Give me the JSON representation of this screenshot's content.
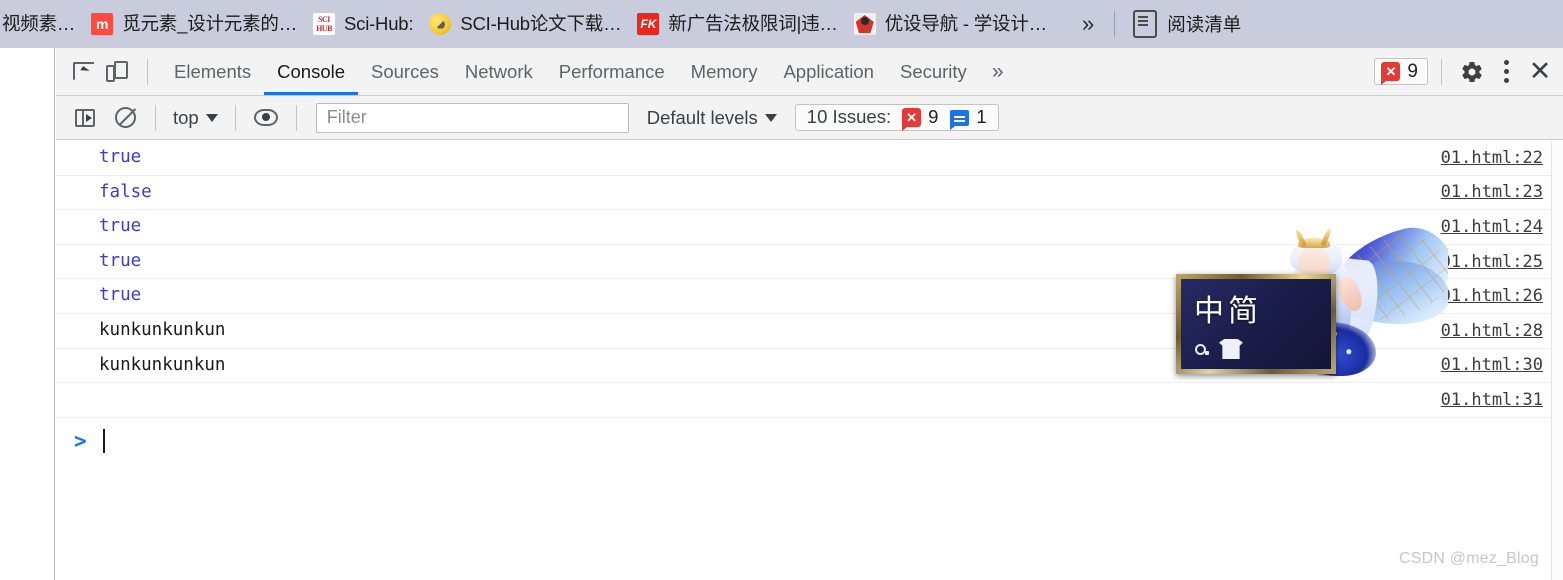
{
  "bookmarks_bar": {
    "items": [
      {
        "label": "视频素…",
        "icon": "clipped-bookmark-icon",
        "icon_kind": "none"
      },
      {
        "label": "觅元素_设计元素的…",
        "icon": "mi-icon",
        "icon_kind": "mi"
      },
      {
        "label": "Sci-Hub:",
        "icon": "sci-hub-icon",
        "icon_kind": "scihub"
      },
      {
        "label": "SCI-Hub论文下载…",
        "icon": "moon-icon",
        "icon_kind": "moon"
      },
      {
        "label": "新广告法极限词|违…",
        "icon": "fk-icon",
        "icon_kind": "fk"
      },
      {
        "label": "优设导航 - 学设计…",
        "icon": "ysj-icon",
        "icon_kind": "ysj"
      }
    ],
    "overflow_label": "»",
    "reading_list_label": "阅读清单"
  },
  "devtools": {
    "toolbar": {
      "inspect_icon": "inspect-element-icon",
      "device_icon": "device-toolbar-icon",
      "tabs": [
        {
          "label": "Elements",
          "active": false
        },
        {
          "label": "Console",
          "active": true
        },
        {
          "label": "Sources",
          "active": false
        },
        {
          "label": "Network",
          "active": false
        },
        {
          "label": "Performance",
          "active": false
        },
        {
          "label": "Memory",
          "active": false
        },
        {
          "label": "Application",
          "active": false
        },
        {
          "label": "Security",
          "active": false
        }
      ],
      "more_tabs_label": "»",
      "error_count": "9",
      "settings_icon": "gear-icon",
      "menu_icon": "kebab-menu-icon",
      "close_icon": "close-icon",
      "accent_color": "#1a73e8",
      "error_color": "#e53935"
    },
    "filterbar": {
      "sidebar_icon": "console-sidebar-icon",
      "clear_icon": "clear-console-icon",
      "context_value": "top",
      "eye_icon": "live-expression-icon",
      "filter_placeholder": "Filter",
      "filter_value": "",
      "levels_value": "Default levels",
      "issues_label": "10 Issues:",
      "issues_error_count": "9",
      "issues_info_count": "1"
    },
    "console_messages": [
      {
        "text": "true",
        "kind": "bool",
        "source": "01.html:22"
      },
      {
        "text": "false",
        "kind": "bool",
        "source": "01.html:23"
      },
      {
        "text": "true",
        "kind": "bool",
        "source": "01.html:24"
      },
      {
        "text": "true",
        "kind": "bool",
        "source": "01.html:25"
      },
      {
        "text": "true",
        "kind": "bool",
        "source": "01.html:26"
      },
      {
        "text": "kunkunkunkun",
        "kind": "plain",
        "source": "01.html:28"
      },
      {
        "text": "kunkunkunkun",
        "kind": "plain",
        "source": "01.html:30"
      },
      {
        "text": "",
        "kind": "plain",
        "source": "01.html:31"
      }
    ],
    "prompt": {
      "arrow": ">",
      "input_value": ""
    }
  },
  "game_overlay": {
    "chip_text": "中简",
    "coin_icon": "coin-icon",
    "shirt_icon": "shirt-icon",
    "character_art": "fairy-character-art"
  },
  "watermark": {
    "text": "CSDN @mez_Blog"
  }
}
